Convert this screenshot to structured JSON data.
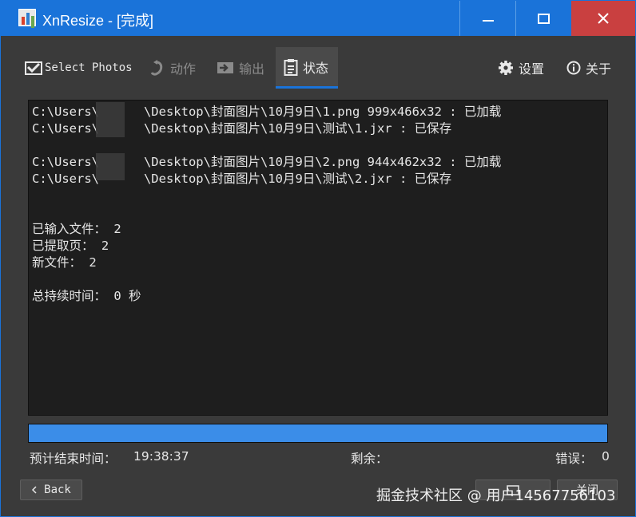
{
  "window": {
    "title": "XnResize - [完成]"
  },
  "toolbar": {
    "select_photos": "Select Photos",
    "actions": "动作",
    "output": "输出",
    "status": "状态",
    "settings": "设置",
    "about": "关于"
  },
  "log": {
    "lines": [
      "C:\\Users\\      \\Desktop\\封面图片\\10月9日\\1.png 999x466x32 : 已加载",
      "C:\\Users\\      \\Desktop\\封面图片\\10月9日\\测试\\1.jxr : 已保存",
      "",
      "C:\\Users\\      \\Desktop\\封面图片\\10月9日\\2.png 944x462x32 : 已加载",
      "C:\\Users\\      \\Desktop\\封面图片\\10月9日\\测试\\2.jxr : 已保存",
      "",
      "",
      "已输入文件： 2",
      "已提取页： 2",
      "新文件： 2",
      "",
      "总持续时间： 0 秒"
    ]
  },
  "progress": {
    "fraction": 1.0
  },
  "status": {
    "eta_label": "预计结束时间：",
    "eta_value": "19:38:37",
    "remaining_label": "剩余：",
    "errors_label": "错误：",
    "errors_value": "0"
  },
  "bottom": {
    "back_label": "Back",
    "close_label": "关闭"
  },
  "watermark": "掘金技术社区 @ 用户14567756103",
  "colors": {
    "accent": "#1a73d9",
    "close": "#c94040",
    "progress": "#3b8de8"
  }
}
